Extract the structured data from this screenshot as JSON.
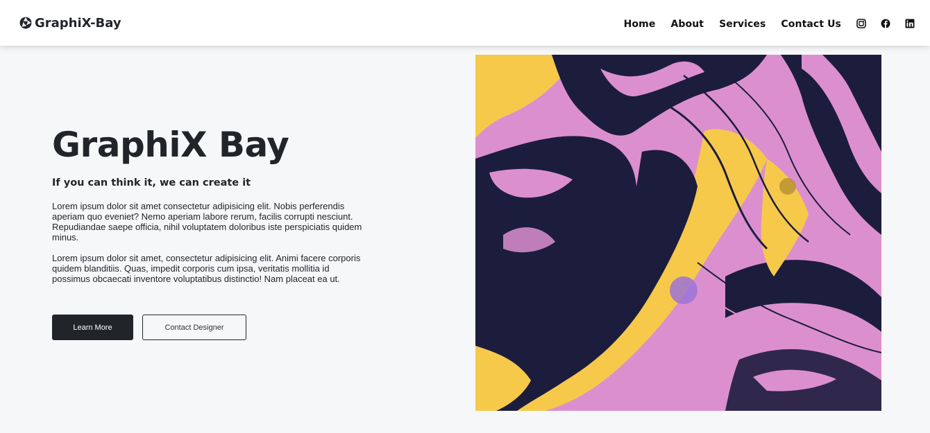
{
  "navbar": {
    "brand": "GraphiX-Bay",
    "brand_icon": "aperture-icon",
    "links": [
      "Home",
      "About",
      "Services",
      "Contact Us"
    ],
    "social_icons": [
      "instagram-icon",
      "facebook-icon",
      "linkedin-icon"
    ]
  },
  "hero": {
    "title": "GraphiX Bay",
    "subtitle": "If you can think it, we can create it",
    "paragraph1": "Lorem ipsum dolor sit amet consectetur adipisicing elit. Nobis perferendis aperiam quo eveniet? Nemo aperiam labore rerum, facilis corrupti nesciunt. Repudiandae saepe officia, nihil voluptatem doloribus iste perspiciatis quidem minus.",
    "paragraph2": "Lorem ipsum dolor sit amet, consectetur adipisicing elit. Animi facere corporis quidem blanditiis. Quas, impedit corporis cum ipsa, veritatis mollitia id possimus obcaecati inventore voluptatibus distinctio! Nam placeat ea ut.",
    "primary_button": "Learn More",
    "secondary_button": "Contact Designer"
  },
  "image": {
    "description_icon": "abstract-paint-image",
    "colors": {
      "pink": "#dc8fcf",
      "navy": "#1c1d3d",
      "yellow": "#f6c94b"
    }
  },
  "colors": {
    "page_bg": "#f6f7f9",
    "dark": "#212529",
    "white": "#ffffff"
  }
}
